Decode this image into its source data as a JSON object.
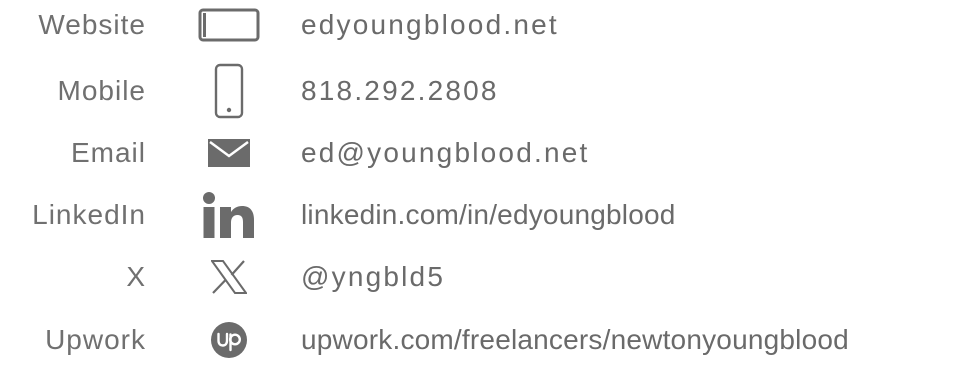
{
  "contacts": [
    {
      "label": "Website",
      "value": "edyoungblood.net",
      "icon": "tablet-icon"
    },
    {
      "label": "Mobile",
      "value": "818.292.2808",
      "icon": "mobile-phone-icon"
    },
    {
      "label": "Email",
      "value": "ed@youngblood.net",
      "icon": "envelope-icon"
    },
    {
      "label": "LinkedIn",
      "value": "linkedin.com/in/edyoungblood",
      "icon": "linkedin-icon"
    },
    {
      "label": "X",
      "value": "@yngbld5",
      "icon": "x-logo-icon"
    },
    {
      "label": "Upwork",
      "value": "upwork.com/freelancers/newtonyoungblood",
      "icon": "upwork-icon"
    }
  ],
  "colors": {
    "text": "#6f6f6f",
    "icon": "#6b6b6b",
    "background": "#ffffff"
  }
}
